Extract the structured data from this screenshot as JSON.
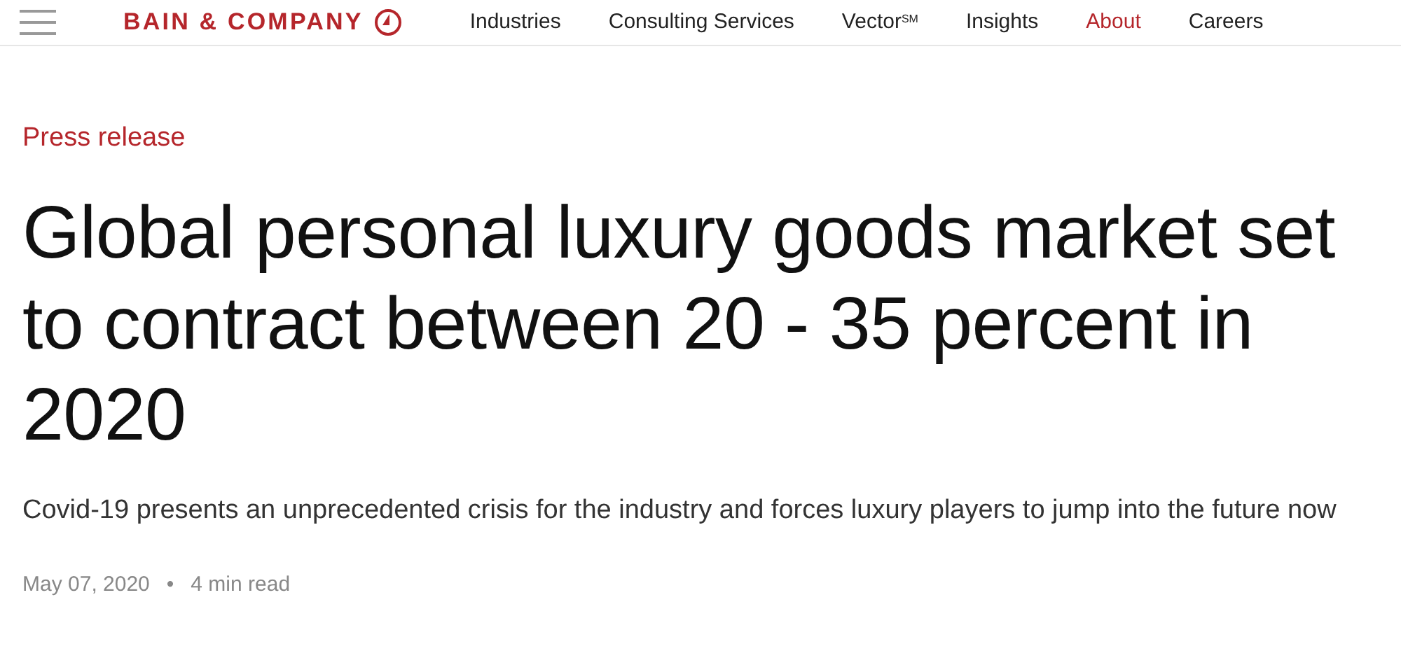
{
  "header": {
    "logo": "BAIN & COMPANY",
    "nav": [
      {
        "label": "Industries",
        "selected": false
      },
      {
        "label": "Consulting Services",
        "selected": false
      },
      {
        "label": "Vector$^{SM}$",
        "selected": false
      },
      {
        "label": "Insights",
        "selected": false
      },
      {
        "label": "About",
        "selected": true
      },
      {
        "label": "Careers",
        "selected": false
      }
    ]
  },
  "article": {
    "category": "Press release",
    "title": "Global personal luxury goods market set to contract between 20 - 35 percent in 2020",
    "subtitle": "Covid-19 presents an unprecedented crisis for the industry and forces luxury players to jump into the future now",
    "date": "May 07, 2020",
    "separator": "•",
    "read_time": "4 min read"
  }
}
